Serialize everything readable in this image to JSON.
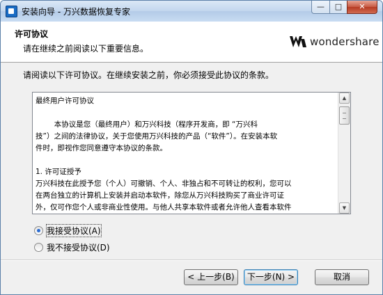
{
  "window": {
    "title": "安装向导 - 万兴数据恢复专家",
    "min_glyph": "—",
    "max_glyph": "□",
    "close_glyph": "✕"
  },
  "header": {
    "title": "许可协议",
    "subtitle": "请在继续之前阅读以下重要信息。",
    "logo_text": "wondershare"
  },
  "content": {
    "intro": "请阅读以下许可协议。在继续安装之前，你必须接受此协议的条款。",
    "license_text": "最终用户许可协议\n\n        本协议是您（最终用户）和万兴科技（程序开发商，即 “万兴科\n技”）之间的法律协议，关于您使用万兴科技的产品（“软件”）。在安装本软\n件时，即视作您同意遵守本协议的条款。\n\n1. 许可证授予\n万兴科技在此授予您（个人）可撤销、个人、非独占和不可转让的权利，您可以\n在两台独立的计算机上安装并启动本软件，除您从万兴科技购买了商业许可证\n外，仅可作您个人或非商业性使用。与他人共享本软件或者允许他人查看本软件\n等未来都被违反许可证，你不可以在网上提供本软件，也不可采用任何"
  },
  "options": {
    "accept": {
      "label": "我接受协议(A)",
      "checked": true
    },
    "decline": {
      "label": "我不接受协议(D)",
      "checked": false
    }
  },
  "buttons": {
    "back": "< 上一步(B)",
    "next": "下一步(N) >",
    "cancel": "取消"
  },
  "colors": {
    "brand": "#222222",
    "accent": "#2a6bd0"
  }
}
